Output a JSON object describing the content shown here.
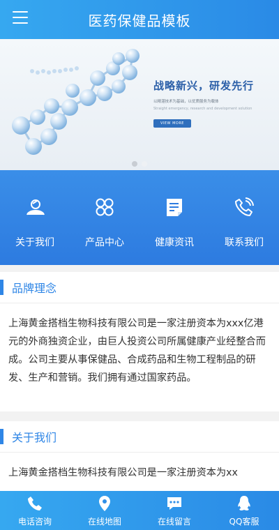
{
  "header": {
    "title": "医药保健品模板"
  },
  "banner": {
    "headline": "战略新兴，研发先行",
    "sub_cn": "以精湛技术为基础，以优质服务为载体",
    "sub_en": "Straight emergency, research and development solution",
    "button": "VIEW MORE"
  },
  "quicknav": {
    "items": [
      {
        "label": "关于我们",
        "icon": "user-icon"
      },
      {
        "label": "产品中心",
        "icon": "grid-icon"
      },
      {
        "label": "健康资讯",
        "icon": "document-icon"
      },
      {
        "label": "联系我们",
        "icon": "phone-icon"
      }
    ]
  },
  "sections": [
    {
      "title": "品牌理念",
      "body": "上海黄金搭档生物科技有限公司是一家注册资本为xxx亿港元的外商独资企业，由巨人投资公司所属健康产业经整合而成。公司主要从事保健品、合成药品和生物工程制品的研发、生产和营销。我们拥有通过国家药品。"
    },
    {
      "title": "关于我们",
      "body": "上海黄金搭档生物科技有限公司是一家注册资本为xx"
    }
  ],
  "bottombar": {
    "items": [
      {
        "label": "电话咨询",
        "icon": "phone-icon"
      },
      {
        "label": "在线地图",
        "icon": "map-pin-icon"
      },
      {
        "label": "在线留言",
        "icon": "chat-icon"
      },
      {
        "label": "QQ客服",
        "icon": "qq-icon"
      }
    ]
  }
}
